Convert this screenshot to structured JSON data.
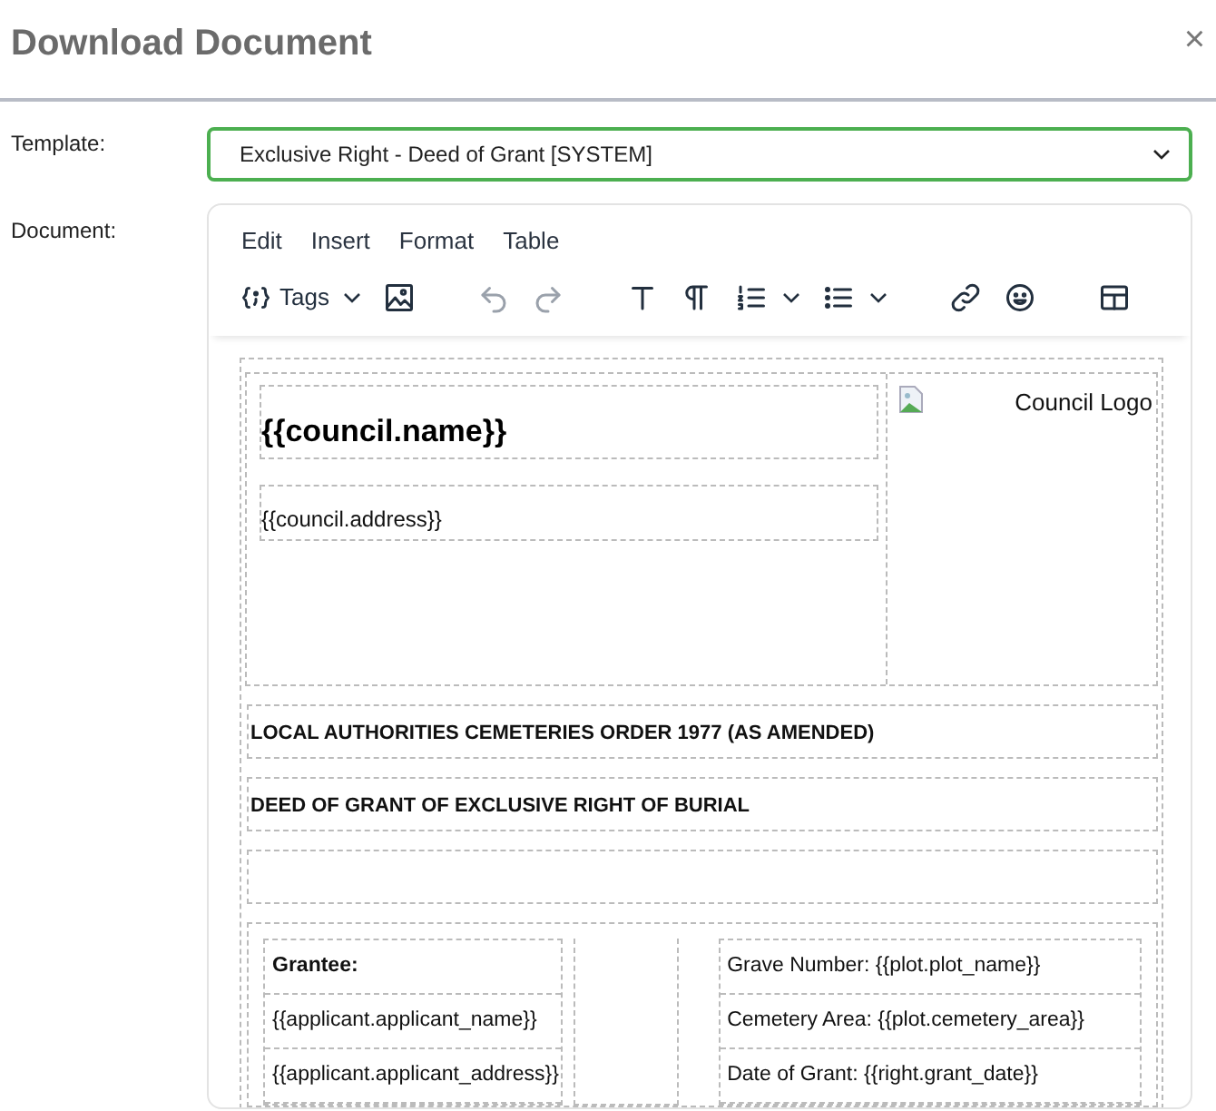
{
  "dialog": {
    "title": "Download Document",
    "close": "×"
  },
  "template": {
    "label": "Template:",
    "value": "Exclusive Right - Deed of Grant [SYSTEM]"
  },
  "document": {
    "label": "Document:"
  },
  "editor": {
    "menu": [
      "Edit",
      "Insert",
      "Format",
      "Table"
    ],
    "toolbar": [
      [
        {
          "kind": "tags",
          "label": "Tags",
          "disabled": false
        },
        {
          "kind": "image",
          "disabled": false
        }
      ],
      [
        {
          "kind": "undo",
          "disabled": true
        },
        {
          "kind": "redo",
          "disabled": true
        }
      ],
      [
        {
          "kind": "text",
          "disabled": false
        },
        {
          "kind": "paragraph",
          "disabled": false
        },
        {
          "kind": "numbered-list",
          "disabled": false
        },
        {
          "kind": "bullet-list",
          "disabled": false
        }
      ],
      [
        {
          "kind": "link",
          "disabled": false
        },
        {
          "kind": "emoji",
          "disabled": false
        }
      ],
      [
        {
          "kind": "table",
          "disabled": false
        }
      ]
    ]
  },
  "content": {
    "council_name": "{{council.name}}",
    "council_address": "{{council.address}}",
    "logo_alt": "Council Logo",
    "headings": [
      "LOCAL AUTHORITIES CEMETERIES ORDER 1977 (AS AMENDED)",
      "DEED OF GRANT OF EXCLUSIVE RIGHT OF BURIAL"
    ],
    "grantee": [
      {
        "kind": "label",
        "text": "Grantee:"
      },
      {
        "kind": "field",
        "text": "{{applicant.applicant_name}}"
      },
      {
        "kind": "field",
        "text": "{{applicant.applicant_address}}"
      }
    ],
    "plot": [
      {
        "text": "Grave Number: {{plot.plot_name}}"
      },
      {
        "text": "Cemetery Area: {{plot.cemetery_area}}"
      },
      {
        "text": "Date of Grant: {{right.grant_date}}"
      }
    ]
  }
}
